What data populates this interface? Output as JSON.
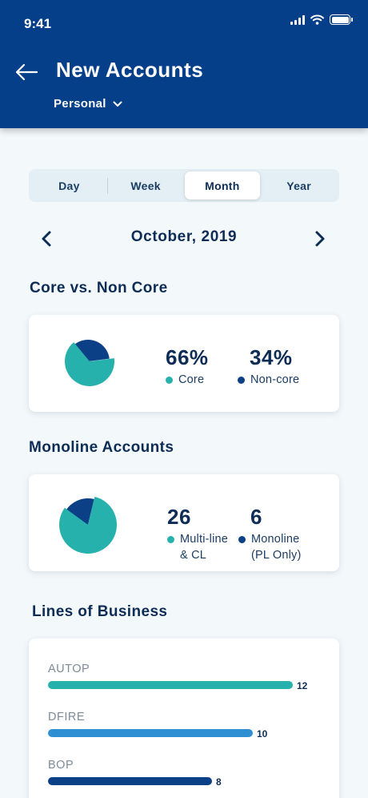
{
  "status_bar": {
    "time": "9:41"
  },
  "header": {
    "title": "New Accounts",
    "account_type": "Personal"
  },
  "period_tabs": [
    {
      "label": "Day",
      "active": false
    },
    {
      "label": "Week",
      "active": false
    },
    {
      "label": "Month",
      "active": true
    },
    {
      "label": "Year",
      "active": false
    }
  ],
  "date_nav": {
    "label": "October, 2019"
  },
  "core_section": {
    "title": "Core vs. Non Core",
    "stats": [
      {
        "value": "66%",
        "label": "Core",
        "color": "#27b1ad"
      },
      {
        "value": "34%",
        "label": "Non-core",
        "color": "#0b3f86"
      }
    ]
  },
  "monoline_section": {
    "title": "Monoline Accounts",
    "stats": [
      {
        "value": "26",
        "label_line1": "Multi-line",
        "label_line2": "& CL",
        "color": "#27b1ad"
      },
      {
        "value": "6",
        "label_line1": "Monoline",
        "label_line2": "(PL Only)",
        "color": "#0b3f86"
      }
    ]
  },
  "lob_section": {
    "title": "Lines of Business",
    "items": [
      {
        "label": "AUTOP",
        "value": "12",
        "fraction": 1.0,
        "color": "#27b1ad"
      },
      {
        "label": "DFIRE",
        "value": "10",
        "fraction": 0.835,
        "color": "#2e90d3"
      },
      {
        "label": "BOP",
        "value": "8",
        "fraction": 0.67,
        "color": "#0b3f86"
      }
    ]
  }
}
